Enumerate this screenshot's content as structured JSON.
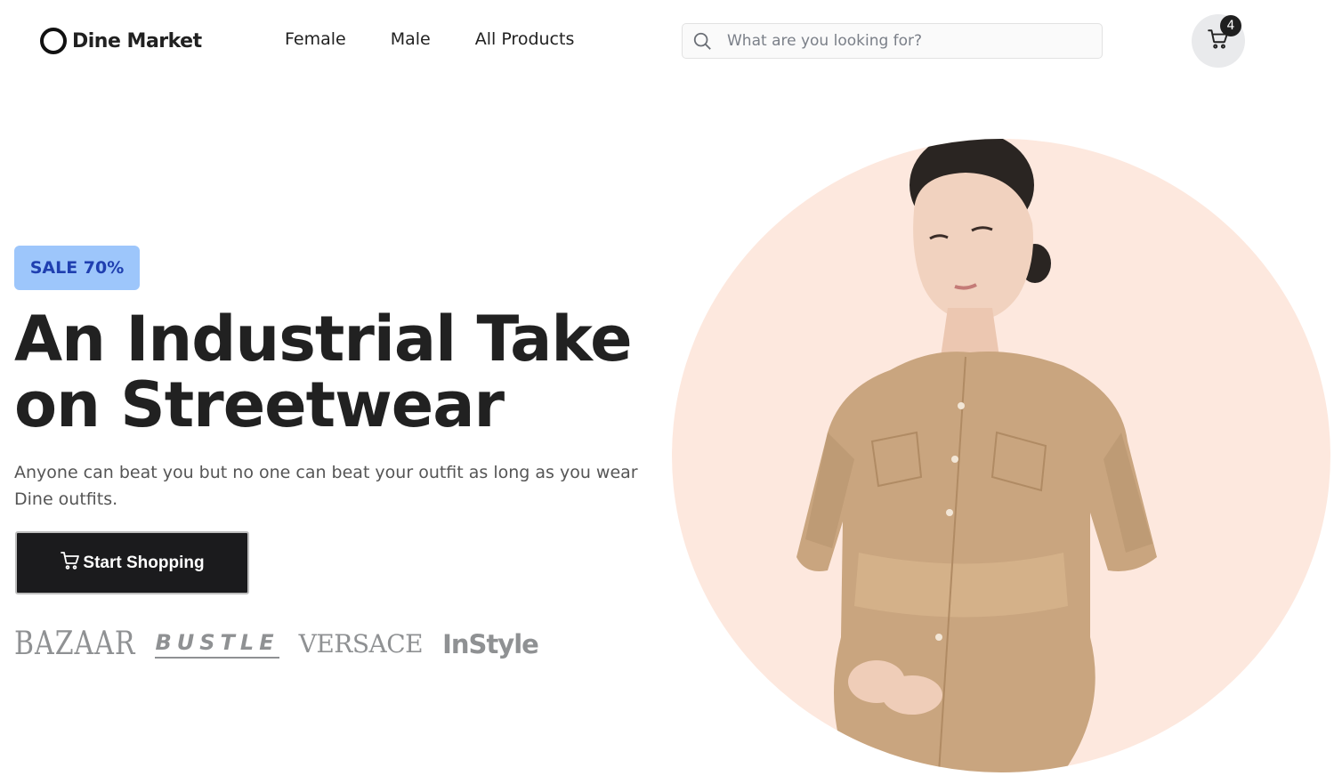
{
  "brand": {
    "name": "Dine Market"
  },
  "nav": {
    "items": [
      "Female",
      "Male",
      "All Products"
    ]
  },
  "search": {
    "placeholder": "What are you looking for?",
    "value": ""
  },
  "cart": {
    "count": "4"
  },
  "hero": {
    "badge": "SALE 70%",
    "title": "An Industrial Take on Streetwear",
    "description": "Anyone can beat you but no one can beat your outfit as long as you wear Dine outfits.",
    "cta_label": "Start Shopping"
  },
  "brands": [
    "BAZAAR",
    "BUSTLE",
    "VERSACE",
    "InStyle"
  ],
  "colors": {
    "badge_bg": "#9dc6fb",
    "badge_text": "#1f3fb0",
    "cta_bg": "#1b1b1d",
    "hero_circle": "#fde8de",
    "text": "#212121"
  },
  "icons": {
    "search": "search-icon",
    "cart": "cart-icon"
  }
}
